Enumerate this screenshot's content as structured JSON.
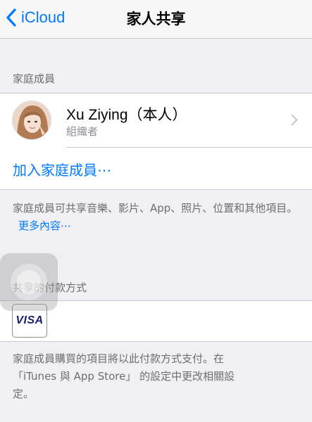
{
  "nav": {
    "back_label": "iCloud",
    "title": "家人共享"
  },
  "family_section": {
    "header": "家庭成員",
    "member": {
      "name": "Xu Ziying（本人）",
      "role": "組織者"
    },
    "add_member_label": "加入家庭成員⋯",
    "footer_text": "家庭成員可共享音樂、影片、App、照片、位置和其他項目。",
    "more_link": "更多內容⋯"
  },
  "payment_section": {
    "header": "共享的付款方式",
    "card_brand": "VISA",
    "footer_line1": "家庭成員購買的項目將以此付款方式支付。在",
    "footer_line2": "「iTunes 與 App Store」 的設定中更改相關設",
    "footer_line3": "定。"
  },
  "colors": {
    "accent": "#007aff",
    "background": "#efeff4",
    "secondary_text": "#6d6d72",
    "separator": "#c8c7cc",
    "visa_blue": "#1a1f71"
  },
  "icons": {
    "back": "chevron-left-icon",
    "disclosure": "chevron-right-icon",
    "card": "visa-card-icon",
    "assistive": "assistive-touch-icon"
  }
}
